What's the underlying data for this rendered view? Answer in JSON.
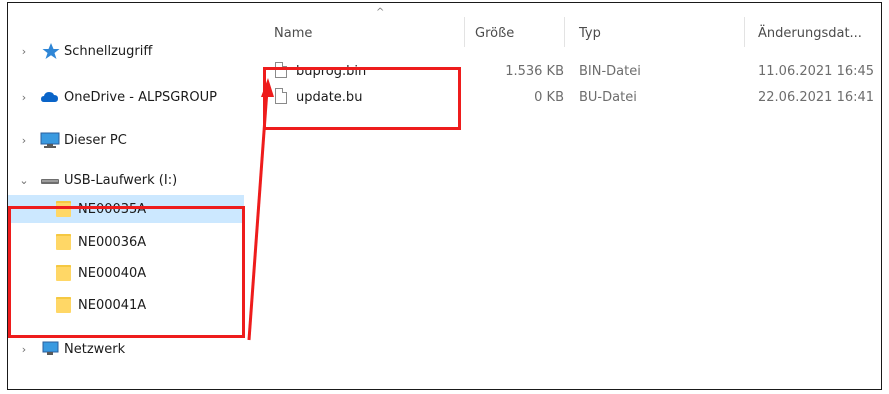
{
  "nav": {
    "items": [
      {
        "label": "Schnellzugriff",
        "icon": "star-icon",
        "chevron": "›"
      },
      {
        "label": "OneDrive - ALPSGROUP",
        "icon": "cloud-icon",
        "chevron": "›"
      },
      {
        "label": "Dieser PC",
        "icon": "computer-icon",
        "chevron": "›"
      },
      {
        "label": "USB-Laufwerk (I:)",
        "icon": "usb-drive-icon",
        "chevron": "⌄"
      },
      {
        "label": "NE00035A",
        "icon": "folder-icon"
      },
      {
        "label": "NE00036A",
        "icon": "folder-icon"
      },
      {
        "label": "NE00040A",
        "icon": "folder-icon"
      },
      {
        "label": "NE00041A",
        "icon": "folder-icon"
      },
      {
        "label": "Netzwerk",
        "icon": "network-icon",
        "chevron": "›"
      }
    ]
  },
  "list": {
    "sort_glyph": "^",
    "columns": {
      "name": "Name",
      "size": "Größe",
      "type": "Typ",
      "modified": "Änderungsdat..."
    },
    "files": [
      {
        "name": "buprog.bin",
        "size": "1.536 KB",
        "type": "BIN-Datei",
        "modified": "11.06.2021 16:45"
      },
      {
        "name": "update.bu",
        "size": "0 KB",
        "type": "BU-Datei",
        "modified": "22.06.2021 16:41"
      }
    ]
  },
  "colors": {
    "selection": "#cce8ff",
    "annotation": "#ee1c1c",
    "folder": "#ffd766"
  }
}
